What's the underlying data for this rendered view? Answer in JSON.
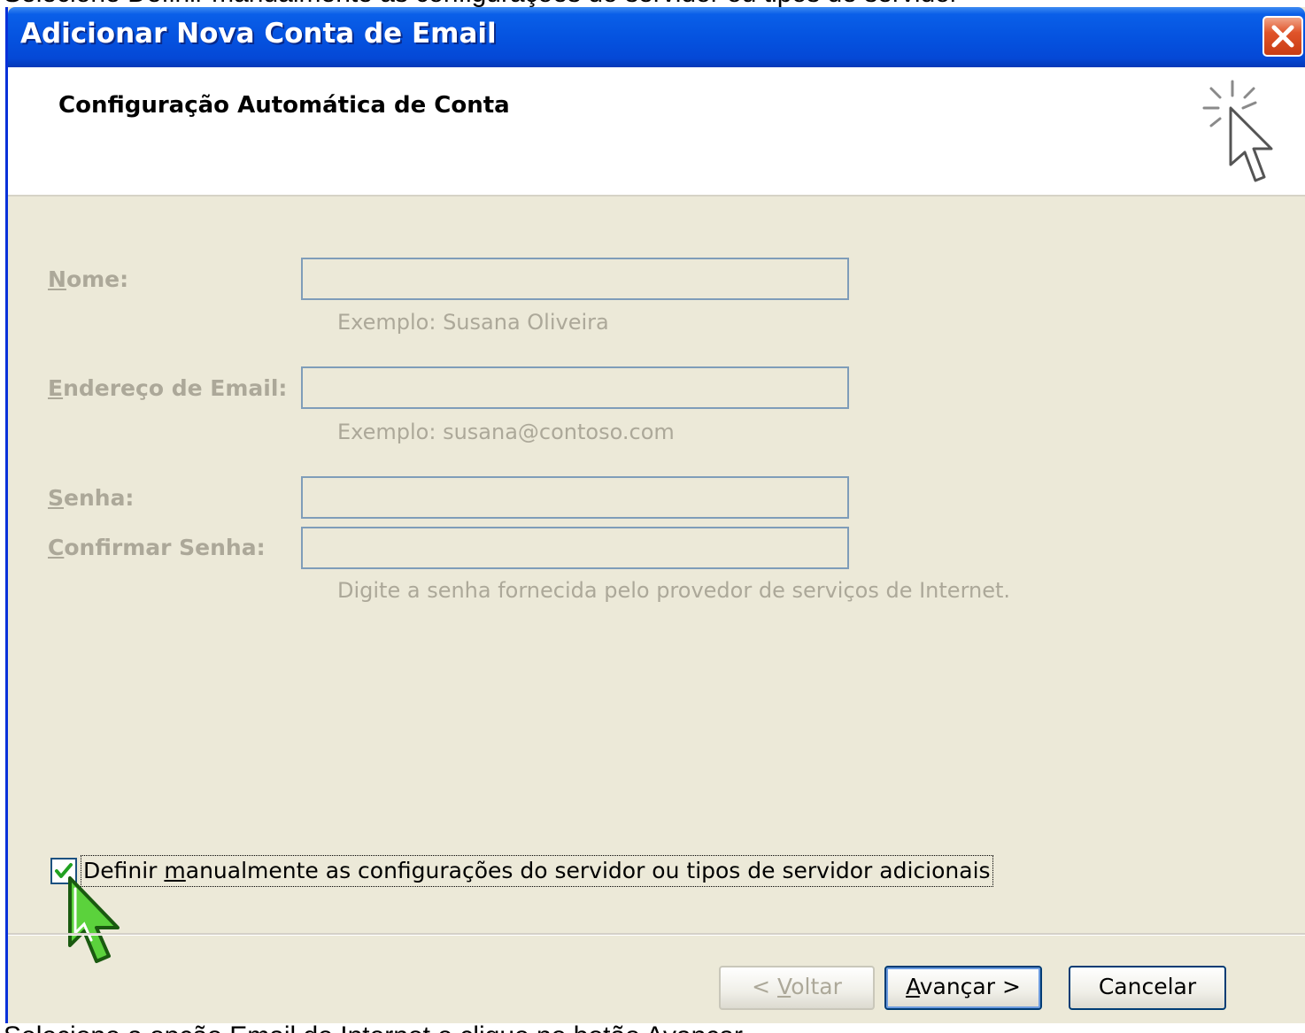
{
  "captions": {
    "top": "Selecione Definir manualmente as configurações do servidor ou tipos de servidor",
    "bottom": "Selecione a opção Email de Internet e clique no botão Avançar"
  },
  "window": {
    "title": "Adicionar Nova Conta de Email",
    "close_icon": "close-icon"
  },
  "header": {
    "title": "Configuração Automática de Conta",
    "icon": "wizard-cursor-sparkle-icon"
  },
  "form": {
    "name": {
      "label_accel": "N",
      "label_rest": "ome:",
      "value": "",
      "hint": "Exemplo: Susana Oliveira"
    },
    "email": {
      "label_accel": "E",
      "label_rest": "ndereço de Email:",
      "value": "",
      "hint": "Exemplo: susana@contoso.com"
    },
    "password": {
      "label_accel": "S",
      "label_rest": "enha:",
      "value": ""
    },
    "confirm": {
      "label_accel": "C",
      "label_rest": "onfirmar Senha:",
      "value": "",
      "hint": "Digite a senha fornecida pelo provedor de serviços de Internet."
    }
  },
  "manual_option": {
    "checked": true,
    "label_pre": "Definir ",
    "label_accel": "m",
    "label_post": "anualmente as configurações do servidor ou tipos de servidor adicionais"
  },
  "buttons": {
    "back": {
      "pre": "< ",
      "accel": "V",
      "post": "oltar"
    },
    "next": {
      "accel": "A",
      "post": "vançar >"
    },
    "cancel": {
      "label": "Cancelar"
    }
  },
  "colors": {
    "titlebar": "#0553e0",
    "dialog_bg": "#ece9d8",
    "disabled_text": "#aca899",
    "pointer_highlight": "#5bd23c"
  }
}
